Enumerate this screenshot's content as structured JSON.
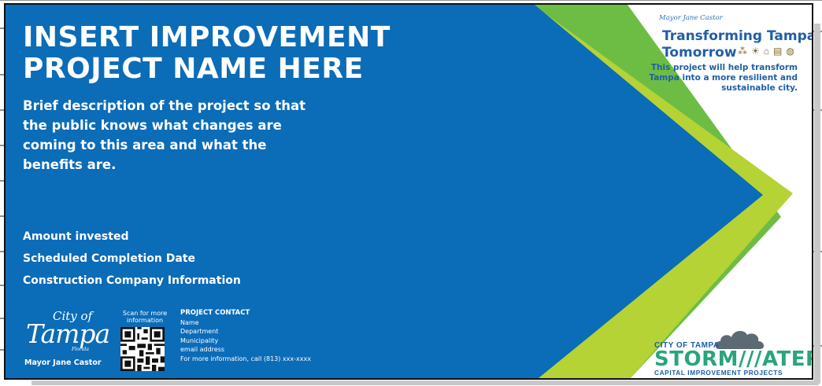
{
  "sign": {
    "title_line1": "INSERT IMPROVEMENT",
    "title_line2": "PROJECT NAME HERE",
    "description": "Brief description of the project so that the public knows what changes are coming to this area and what the benefits are.",
    "amount_label": "Amount invested",
    "completion_label": "Scheduled Completion Date",
    "company_label": "Construction Company Information"
  },
  "footer": {
    "city_of": "City of",
    "tampa": "Tampa",
    "florida": "Florida",
    "mayor": "Mayor Jane Castor",
    "scan_text": "Scan for more information",
    "contact_heading": "PROJECT CONTACT",
    "contact_name": "Name",
    "contact_department": "Department",
    "contact_municipality": "Municipality",
    "contact_email": "email address",
    "contact_phone": "For more information, call (813) xxx-xxxx"
  },
  "brand": {
    "signature": "Mayor Jane Castor",
    "tagline_line1": "Transforming Tampa's",
    "tagline_line2": "Tomorrow",
    "icons": [
      "people-icon",
      "lightbulb-icon",
      "house-icon",
      "building-icon",
      "globe-icon"
    ],
    "subtext": "This project will help transform Tampa into a more resilient and sustainable city."
  },
  "stormwater": {
    "city": "CITY OF TAMPA",
    "name": "STORM///ATER",
    "sub": "CAPITAL IMPROVEMENT PROJECTS"
  },
  "colors": {
    "blue": "#0b6cb8",
    "lime": "#b5d334",
    "green": "#6dbd45",
    "teal": "#2aa47b"
  }
}
